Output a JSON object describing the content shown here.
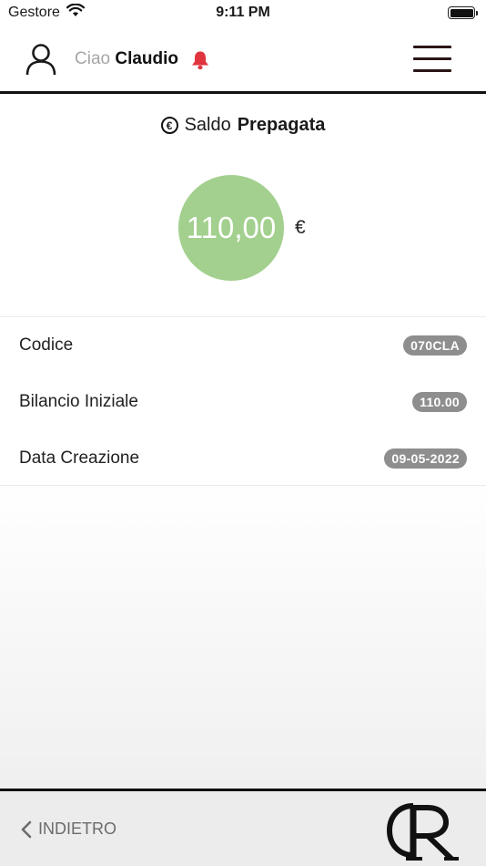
{
  "status_bar": {
    "carrier": "Gestore",
    "time": "9:11 PM",
    "icons": [
      "wifi-icon",
      "battery-icon"
    ]
  },
  "header": {
    "greeting_word": "Ciao",
    "user_name": "Claudio",
    "icons": [
      "user-icon",
      "bell-icon",
      "menu-icon"
    ],
    "bell_color": "#e0343e"
  },
  "balance": {
    "title_prefix": "Saldo",
    "title_bold": "Prepagata",
    "amount": "110,00",
    "currency": "€",
    "circle_color": "#a3d08e"
  },
  "details": {
    "rows": [
      {
        "label": "Codice",
        "value": "070CLA"
      },
      {
        "label": "Bilancio Iniziale",
        "value": "110.00"
      },
      {
        "label": "Data Creazione",
        "value": "09-05-2022"
      }
    ]
  },
  "footer": {
    "back_label": "INDIETRO"
  }
}
